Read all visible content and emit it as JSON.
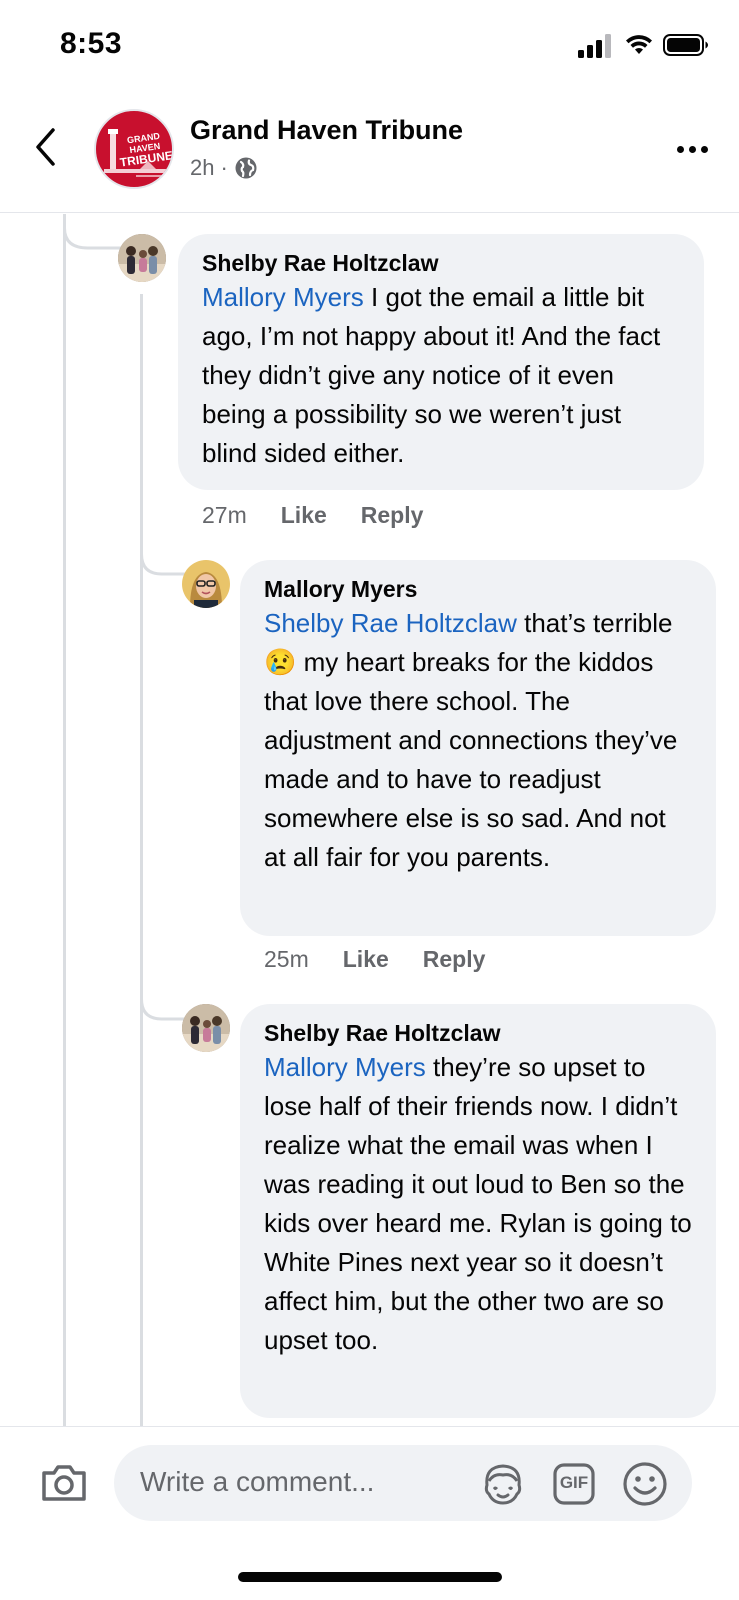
{
  "status_bar": {
    "time": "8:53"
  },
  "header": {
    "page_name": "Grand Haven Tribune",
    "post_age": "2h",
    "separator": "·",
    "logo_line1": "GRAND HAVEN",
    "logo_line2": "TRIBUNE"
  },
  "comments": [
    {
      "author": "Shelby Rae Holtzclaw",
      "mention": "Mallory Myers",
      "text": " I got the email a little bit ago, I’m not happy about it! And the fact they didn’t give any notice of it even being a possibility so we weren’t just blind sided either.",
      "time": "27m",
      "like_label": "Like",
      "reply_label": "Reply"
    },
    {
      "author": "Mallory Myers",
      "mention": "Shelby Rae Holtzclaw",
      "text_before_emoji": " that’s terrible ",
      "emoji": "😢",
      "text": " my heart breaks for the kiddos that love there school. The adjustment and connections they’ve made and to have to readjust somewhere else is so sad. And not at all fair for you parents.",
      "time": "25m",
      "like_label": "Like",
      "reply_label": "Reply"
    },
    {
      "author": "Shelby Rae Holtzclaw",
      "mention": "Mallory Myers",
      "text": " they’re so upset to lose half of their friends now. I didn’t realize what the email was when I was reading it out loud to Ben so the kids over heard me. Rylan is going to White Pines next year so it doesn’t affect him, but the other two are so upset too."
    }
  ],
  "composer": {
    "placeholder": "Write a comment...",
    "gif_label": "GIF"
  },
  "colors": {
    "bubble_bg": "#f0f2f5",
    "mention": "#1b64c0",
    "secondary_text": "#65676b",
    "brand_red": "#c8102e"
  }
}
